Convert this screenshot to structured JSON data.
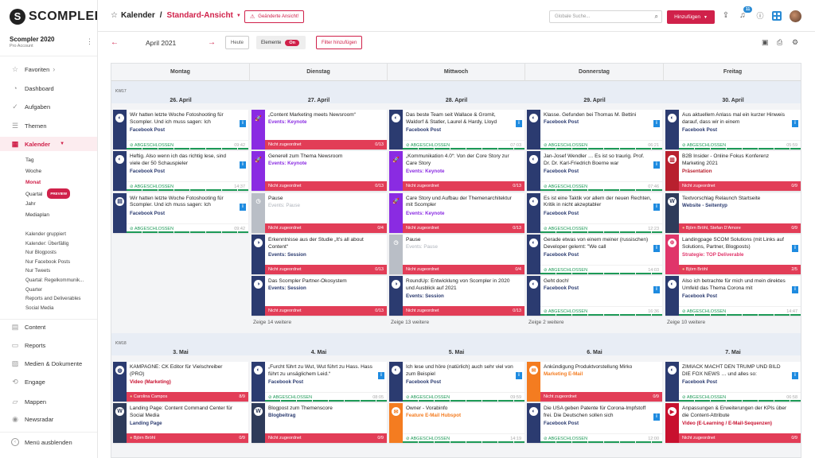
{
  "brand": {
    "name": "SCOMPLER",
    "mark": "S"
  },
  "account": {
    "name": "Scompler 2020",
    "plan": "Pro Account"
  },
  "sidebar": {
    "nav_top": [
      {
        "label": "Favoriten",
        "icon": "star-icon"
      },
      {
        "label": "Dashboard",
        "icon": "dashboard-icon"
      },
      {
        "label": "Aufgaben",
        "icon": "check-icon"
      },
      {
        "label": "Themen",
        "icon": "topics-icon"
      }
    ],
    "calendar": {
      "label": "Kalender",
      "icon": "calendar-icon"
    },
    "calendar_sub": [
      "Tag",
      "Woche",
      "Monat",
      "Quartal",
      "Jahr",
      "Mediaplan"
    ],
    "preview_label": "PREVIEW",
    "saved_views": [
      "Kalender gruppiert",
      "Kalender: Überfällig",
      "Nur Blogposts",
      "Nur Facebook Posts",
      "Nur Tweets",
      "Quartal: Regelkommunik...",
      "Quarter",
      "Reports and Deliverables",
      "Social Media"
    ],
    "nav_bottom": [
      {
        "label": "Content",
        "icon": "content-icon"
      },
      {
        "label": "Reports",
        "icon": "reports-icon"
      },
      {
        "label": "Medien & Dokumente",
        "icon": "media-icon"
      },
      {
        "label": "Engage",
        "icon": "engage-icon"
      },
      {
        "label": "Mappen",
        "icon": "folder-icon"
      },
      {
        "label": "Newsradar",
        "icon": "radar-icon"
      }
    ],
    "hide_menu": "Menü ausblenden"
  },
  "header": {
    "section": "Kalender",
    "view": "Standard-Ansicht",
    "changed": "Geänderte Ansicht!",
    "search_placeholder": "Globale Suche...",
    "add_label": "Hinzufügen",
    "notif_count": "11"
  },
  "toolbar": {
    "month": "April 2021",
    "today": "Heute",
    "elements": "Elemente",
    "elements_state": "On",
    "filter": "Filter hinzufügen"
  },
  "colors": {
    "accent": "#d0214a",
    "facebook": "#2b3b70",
    "keynote": "#8a2be2",
    "pause": "#b9bec6",
    "session": "#2b3b70",
    "wordpress": "#2e3b5a",
    "email": "#f47c20",
    "video": "#c8102e",
    "presentation": "#b8202e",
    "strategy": "#e0356a"
  },
  "days": [
    "Montag",
    "Dienstag",
    "Mittwoch",
    "Donnerstag",
    "Freitag"
  ],
  "weeks": [
    {
      "label": "KW17",
      "dates": [
        "26. April",
        "27. April",
        "28. April",
        "29. April",
        "30. April"
      ],
      "more": [
        "",
        "Zeige 14 weitere",
        "Zeige 13 weitere",
        "Zeige 2 weitere",
        "Zeige 10 weitere"
      ],
      "cols": [
        [
          {
            "title": "Wir hatten letzte Woche Fotoshooting für Scompler. Und ich muss sagen: Ich",
            "type": "Facebook Post",
            "kind": "fb",
            "info": true,
            "status": "done",
            "time": "09:42"
          },
          {
            "title": "Heftig. Also wenn ich das richtig lese, sind viele der 50 Schauspieler",
            "type": "Facebook Post",
            "kind": "fb",
            "info": true,
            "status": "done",
            "time": "14:37"
          },
          {
            "title": "Wir hatten letzte Woche Fotoshooting für Scompler. Und ich muss sagen: Ich",
            "type": "Facebook Post",
            "kind": "fb2",
            "info": true,
            "status": "done",
            "time": "09:42"
          }
        ],
        [
          {
            "title": "„Content Marketing meets Newsroom“",
            "type": "Events: Keynote",
            "kind": "keynote",
            "status": "red",
            "label": "Nicht zugeordnet",
            "count": "0/13"
          },
          {
            "title": "Generell zum Thema Newsroom",
            "type": "Events: Keynote",
            "kind": "keynote",
            "status": "red",
            "label": "Nicht zugeordnet",
            "count": "0/13"
          },
          {
            "title": "Pause",
            "type": "Events: Pause",
            "kind": "pause",
            "status": "red",
            "label": "Nicht zugeordnet",
            "count": "0/4"
          },
          {
            "title": "Erkenntnisse aus der Studie „It's all about Content“",
            "type": "Events: Session",
            "kind": "session",
            "status": "red",
            "label": "Nicht zugeordnet",
            "count": "0/13"
          },
          {
            "title": "Das Scompler Partner-Ökosystem",
            "type": "Events: Session",
            "kind": "session",
            "status": "red",
            "label": "Nicht zugeordnet",
            "count": "0/13"
          }
        ],
        [
          {
            "title": "Das beste Team seit Wallace & Gromit, Waldorf & Statler, Laurel & Hardy, Lloyd",
            "type": "Facebook Post",
            "kind": "fb",
            "info": true,
            "status": "done",
            "time": "07:03"
          },
          {
            "title": "„Kommunikation 4.0“: Von der Core Story zur Care Story",
            "type": "Events: Keynote",
            "kind": "keynote",
            "status": "red",
            "label": "Nicht zugeordnet",
            "count": "0/13"
          },
          {
            "title": "Care Story und Aufbau der Themenarchitektur mit Scompler",
            "type": "Events: Keynote",
            "kind": "keynote",
            "status": "red",
            "label": "Nicht zugeordnet",
            "count": "0/13"
          },
          {
            "title": "Pause",
            "type": "Events: Pause",
            "kind": "pause",
            "status": "red",
            "label": "Nicht zugeordnet",
            "count": "0/4"
          },
          {
            "title": "RoundUp: Entwicklung von Scompler in 2020 und Ausblick auf 2021",
            "type": "Events: Session",
            "kind": "session",
            "status": "red",
            "label": "Nicht zugeordnet",
            "count": "0/13"
          }
        ],
        [
          {
            "title": "Klasse. Gefunden bei Thomas M. Bettini",
            "type": "Facebook Post",
            "kind": "fb",
            "info": true,
            "status": "done",
            "time": "06:21"
          },
          {
            "title": "Jan-Josef Wendler … Es ist so traurig. Prof. Dr. Dr. Karl-Friedrich Boerne war",
            "type": "Facebook Post",
            "kind": "fb",
            "info": true,
            "status": "done",
            "time": "07:46"
          },
          {
            "title": "Es ist eine Taktik vor allem der neuen Rechten, Kritik in nicht akzeptabler",
            "type": "Facebook Post",
            "kind": "fb",
            "info": true,
            "status": "done",
            "time": "12:23"
          },
          {
            "title": "Gerade etwas von einem meiner (russischen) Developer gelernt: \"We call",
            "type": "Facebook Post",
            "kind": "fb",
            "info": true,
            "status": "done",
            "time": "14:03"
          },
          {
            "title": "Geht doch!",
            "type": "Facebook Post",
            "kind": "fb",
            "info": true,
            "status": "done",
            "time": "16:36"
          }
        ],
        [
          {
            "title": "Aus aktuellem Anlass mal ein kurzer Hinweis darauf, dass wir in einem",
            "type": "Facebook Post",
            "kind": "fb",
            "info": true,
            "status": "done",
            "time": "05:59"
          },
          {
            "title": "B2B Insider - Online Fokus Konferenz Marketing 2021",
            "type": "Präsentation",
            "kind": "presentation",
            "status": "red",
            "label": "Nicht zugeordnet",
            "count": "0/9"
          },
          {
            "title": "Textvorschlag Relaunch Startseite",
            "type": "Website - Seitentyp",
            "kind": "wordpress",
            "status": "red",
            "label": "Björn Bröhl, Stefan D'Amore",
            "count": "0/9",
            "user": true
          },
          {
            "title": "Landingpage SCOM Solutions (mit Links auf Solutions, Partner, Blogposts)",
            "type": "Strategie: TOP Deliverable",
            "kind": "strategy",
            "info": true,
            "status": "red",
            "label": "Björn Bröhl",
            "count": "2/5",
            "user": true
          },
          {
            "title": "Also ich betrachte für mich und mein direktes Umfeld das Thema Corona mit",
            "type": "Facebook Post",
            "kind": "fb",
            "info": true,
            "status": "done",
            "time": "14:47"
          }
        ]
      ]
    },
    {
      "label": "KW18",
      "dates": [
        "3. Mai",
        "4. Mai",
        "5. Mai",
        "6. Mai",
        "7. Mai"
      ],
      "more": [
        "",
        "",
        "",
        "",
        ""
      ],
      "cols": [
        [
          {
            "title": "KAMPAGNE: CK Editor für Vielschreiber (PRO)",
            "type": "Video (Marketing)",
            "kind": "video2",
            "status": "red",
            "label": "Carolina Campos",
            "count": "8/9",
            "user": true
          },
          {
            "title": "Landing Page: Content Command Center für Social Media",
            "type": "Landing Page",
            "kind": "wordpress",
            "status": "red",
            "label": "Björn Bröhl",
            "count": "0/9",
            "user": true
          }
        ],
        [
          {
            "title": "„Furcht führt zu Wut, Wut führt zu Hass. Hass führt zu unsäglichem Leid.“",
            "type": "Facebook Post",
            "kind": "fb",
            "info": true,
            "status": "done",
            "time": "08:05"
          },
          {
            "title": "Blogpost zum Themenscore",
            "type": "Blogbeitrag",
            "kind": "wordpress",
            "status": "red",
            "label": "Nicht zugeordnet",
            "count": "0/9"
          }
        ],
        [
          {
            "title": "Ich lese und höre (natürlich) auch sehr viel von zum Beispiel",
            "type": "Facebook Post",
            "kind": "fb",
            "info": true,
            "status": "done",
            "time": "09:59"
          },
          {
            "title": "Owner - Vorabinfo",
            "type": "Feature E-Mail Hubspot",
            "kind": "email",
            "status": "done",
            "time": "14:19"
          }
        ],
        [
          {
            "title": "Ankündigung Produktvorstellung Mirko",
            "type": "Marketing E-Mail",
            "kind": "email",
            "status": "red",
            "label": "Nicht zugeordnet",
            "count": "0/9"
          },
          {
            "title": "Die USA geben Patente für Corona-Impfstoff frei. Die Deutschen sollen sich",
            "type": "Facebook Post",
            "kind": "fb",
            "info": true,
            "status": "done",
            "time": "12:00"
          }
        ],
        [
          {
            "title": "ZIMIACK MACHT DEN TRUMP UND BILD DIE FOX NEWS … und alles so:",
            "type": "Facebook Post",
            "kind": "fb",
            "info": true,
            "status": "done",
            "time": "06:58"
          },
          {
            "title": "Anpassungen & Erweiterungen der KPIs über die Content-Attribute",
            "type": "Video (E-Learning / E-Mail-Sequenzen)",
            "kind": "video",
            "status": "red",
            "label": "Nicht zugeordnet",
            "count": "0/9"
          }
        ]
      ]
    }
  ],
  "status_done": "ABGESCHLOSSEN"
}
